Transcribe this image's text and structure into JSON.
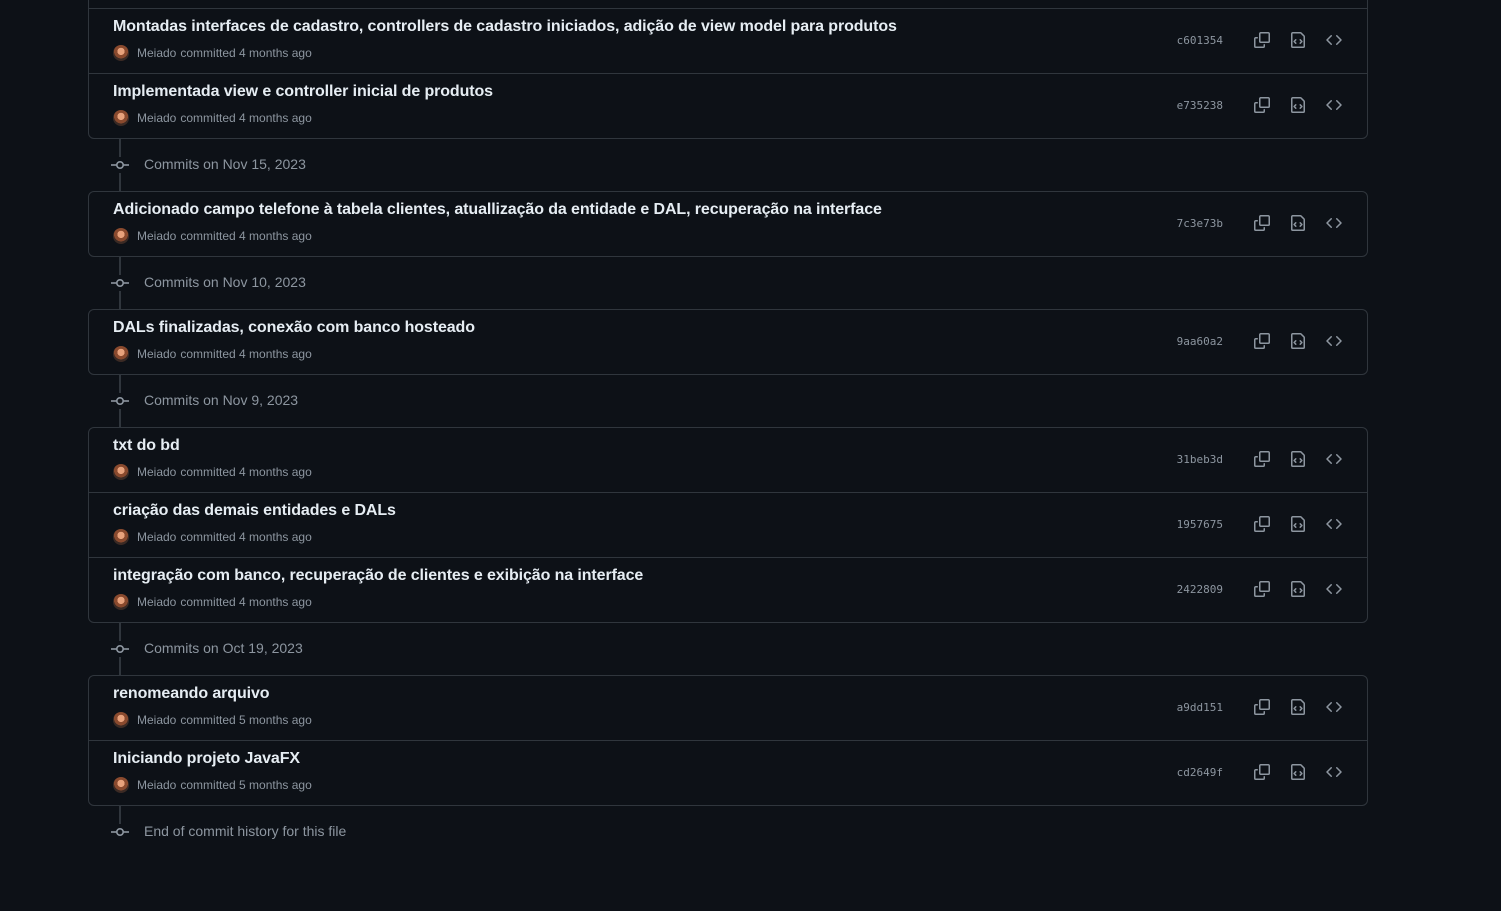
{
  "groups": [
    {
      "header": null,
      "commits": [
        {
          "title": "Montadas interfaces de cadastro, controllers de cadastro iniciados, adição de view model para produtos",
          "author": "Meiado",
          "committed": "committed 4 months ago",
          "sha": "c601354"
        },
        {
          "title": "Implementada view e controller inicial de produtos",
          "author": "Meiado",
          "committed": "committed 4 months ago",
          "sha": "e735238"
        }
      ]
    },
    {
      "header": "Commits on Nov 15, 2023",
      "commits": [
        {
          "title": "Adicionado campo telefone à tabela clientes, atuallização da entidade e DAL, recuperação na interface",
          "author": "Meiado",
          "committed": "committed 4 months ago",
          "sha": "7c3e73b"
        }
      ]
    },
    {
      "header": "Commits on Nov 10, 2023",
      "commits": [
        {
          "title": "DALs finalizadas, conexão com banco hosteado",
          "author": "Meiado",
          "committed": "committed 4 months ago",
          "sha": "9aa60a2"
        }
      ]
    },
    {
      "header": "Commits on Nov 9, 2023",
      "commits": [
        {
          "title": "txt do bd",
          "author": "Meiado",
          "committed": "committed 4 months ago",
          "sha": "31beb3d"
        },
        {
          "title": "criação das demais entidades e DALs",
          "author": "Meiado",
          "committed": "committed 4 months ago",
          "sha": "1957675"
        },
        {
          "title": "integração com banco, recuperação de clientes e exibição na interface",
          "author": "Meiado",
          "committed": "committed 4 months ago",
          "sha": "2422809"
        }
      ]
    },
    {
      "header": "Commits on Oct 19, 2023",
      "commits": [
        {
          "title": "renomeando arquivo",
          "author": "Meiado",
          "committed": "committed 5 months ago",
          "sha": "a9dd151"
        },
        {
          "title": "Iniciando projeto JavaFX",
          "author": "Meiado",
          "committed": "committed 5 months ago",
          "sha": "cd2649f"
        }
      ]
    }
  ],
  "end_text": "End of commit history for this file",
  "icons": {
    "copy": "copy-icon",
    "browse": "file-diff-icon",
    "code": "code-icon",
    "timeline": "git-commit-icon",
    "avatar": "avatar"
  },
  "colors": {
    "background": "#0d1117",
    "border": "#30363d",
    "text": "#e6edf3",
    "muted": "#8d96a0"
  }
}
